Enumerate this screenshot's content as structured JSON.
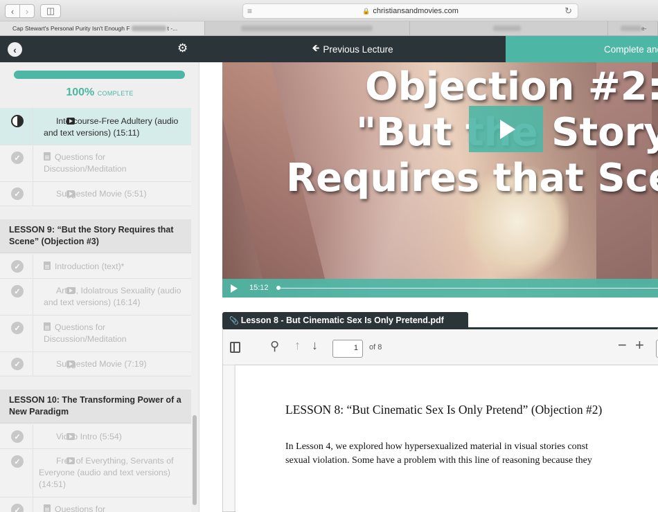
{
  "browser": {
    "url": "christiansandmovies.com",
    "tabs": [
      {
        "label": "Cap Stewart's Personal Purity Isn't Enough F",
        "suffix": "t -..."
      },
      {
        "label": ""
      },
      {
        "label": ""
      },
      {
        "label": "",
        "suffix": "e-"
      }
    ]
  },
  "header": {
    "prev_label": "Previous Lecture",
    "complete_label": "Complete and Continue"
  },
  "sidebar": {
    "progress": {
      "percent_value": 1.0,
      "percent_text": "100%",
      "label": "COMPLETE"
    },
    "rows_top": [
      {
        "title": "Intercourse-Free Adultery (audio and text versions) (15:11)",
        "icon": "video",
        "state": "active"
      },
      {
        "title": "Questions for Discussion/Meditation",
        "icon": "doc",
        "state": "done"
      },
      {
        "title": "Suggested Movie (5:51)",
        "icon": "video",
        "state": "done"
      }
    ],
    "lesson9": {
      "title": "LESSON 9: “But the Story Requires that Scene” (Objection #3)",
      "rows": [
        {
          "title": "Introduction (text)*",
          "icon": "doc"
        },
        {
          "title": "Artful, Idolatrous Sexuality (audio and text versions) (16:14)",
          "icon": "video"
        },
        {
          "title": "Questions for Discussion/Meditation",
          "icon": "doc"
        },
        {
          "title": "Suggested Movie (7:19)",
          "icon": "video"
        }
      ]
    },
    "lesson10": {
      "title": "LESSON 10: The Transforming Power of a New Paradigm",
      "rows": [
        {
          "title": "Video Intro (5:54)",
          "icon": "video"
        },
        {
          "title": "Free of Everything, Servants of Everyone (audio and text versions) (14:51)",
          "icon": "video"
        },
        {
          "title": "Questions for",
          "icon": "doc"
        }
      ]
    }
  },
  "video": {
    "title_lines": [
      "Objection #2:",
      "\"But the Story",
      "Requires that Sce"
    ],
    "time": "15:12"
  },
  "pdf": {
    "filename": "Lesson 8 - But Cinematic Sex Is Only Pretend.pdf",
    "page_current": "1",
    "page_total_label": "of 8",
    "heading": "LESSON 8: “But Cinematic Sex Is Only Pretend” (Objection #2)",
    "body_lines": [
      "In Lesson 4, we explored how hypersexualized material in visual stories const",
      "sexual violation. Some have a problem with this line of reasoning because they"
    ]
  },
  "colors": {
    "accent": "#4db6a5",
    "header_bg": "#2b3539"
  }
}
